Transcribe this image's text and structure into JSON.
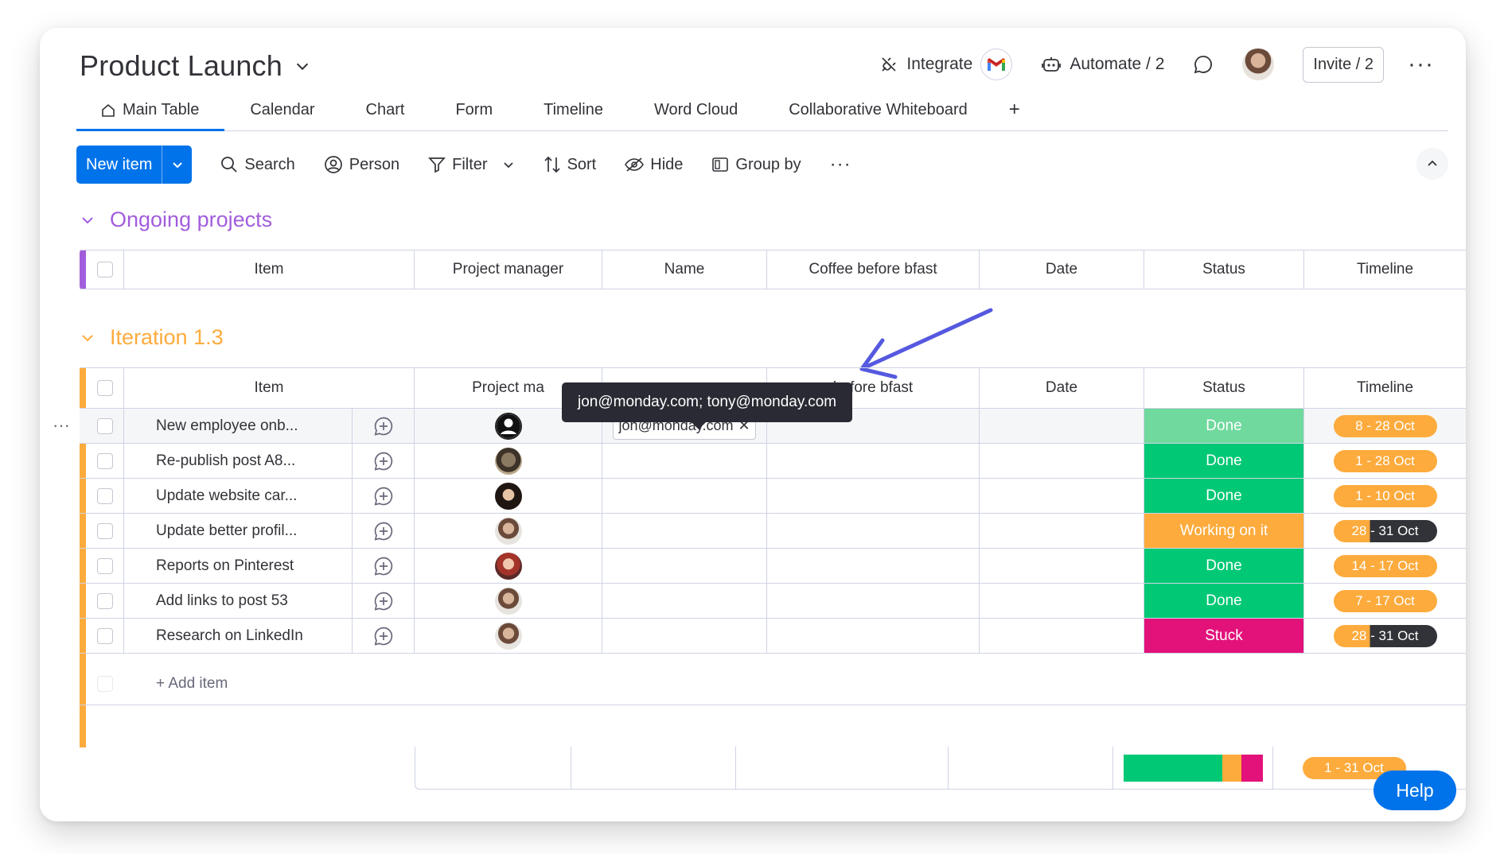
{
  "board": {
    "title": "Product Launch"
  },
  "header": {
    "integrate_label": "Integrate",
    "automate_label": "Automate / 2",
    "invite_label": "Invite / 2",
    "more": "···"
  },
  "tabs": [
    {
      "label": "Main Table",
      "active": true
    },
    {
      "label": "Calendar"
    },
    {
      "label": "Chart"
    },
    {
      "label": "Form"
    },
    {
      "label": "Timeline"
    },
    {
      "label": "Word Cloud"
    },
    {
      "label": "Collaborative Whiteboard"
    }
  ],
  "tab_add": "+",
  "toolbar": {
    "new_item": "New item",
    "search": "Search",
    "person": "Person",
    "filter": "Filter",
    "sort": "Sort",
    "hide": "Hide",
    "group_by": "Group by",
    "more": "···"
  },
  "columns": [
    "Item",
    "Project manager",
    "Name",
    "Coffee before bfast",
    "Date",
    "Status",
    "Timeline"
  ],
  "groups": {
    "ongoing": {
      "title": "Ongoing projects",
      "color": "#a25ddc"
    },
    "iteration": {
      "title": "Iteration 1.3",
      "color": "#fdab3d"
    }
  },
  "iteration_header": {
    "item": "Item",
    "project_manager_partial": "Project ma",
    "coffee_partial": "before bfast",
    "date": "Date",
    "status": "Status",
    "timeline": "Timeline"
  },
  "rows": [
    {
      "item": "New employee onb...",
      "status": "Done",
      "status_color": "#70d99e",
      "timeline": "8 - 28 Oct",
      "email": "jon@monday.com",
      "avatar": "silhouette"
    },
    {
      "item": "Re-publish post A8...",
      "status": "Done",
      "status_color": "#00c875",
      "timeline": "1 - 28 Oct",
      "avatar": "dog"
    },
    {
      "item": "Update website car...",
      "status": "Done",
      "status_color": "#00c875",
      "timeline": "1 - 10 Oct",
      "avatar": "woman-dark"
    },
    {
      "item": "Update better profil...",
      "status": "Working on it",
      "status_color": "#fdab3d",
      "timeline": "28 - 31 Oct",
      "timeline_progress": 0.35,
      "avatar": "woman-light"
    },
    {
      "item": "Reports on Pinterest",
      "status": "Done",
      "status_color": "#00c875",
      "timeline": "14 - 17 Oct",
      "avatar": "woman-red"
    },
    {
      "item": "Add links to post 53",
      "status": "Done",
      "status_color": "#00c875",
      "timeline": "7 - 17 Oct",
      "avatar": "woman-light"
    },
    {
      "item": "Research on LinkedIn",
      "status": "Stuck",
      "status_color": "#e2127a",
      "timeline": "28 - 31 Oct",
      "timeline_progress": 0.35,
      "avatar": "woman-light"
    }
  ],
  "add_item": "+ Add item",
  "tooltip": "jon@monday.com; tony@monday.com",
  "summary": {
    "status_breakdown": [
      {
        "color": "#00c875",
        "share": 0.71
      },
      {
        "color": "#fdab3d",
        "share": 0.14
      },
      {
        "color": "#e2127a",
        "share": 0.15
      }
    ],
    "timeline": "1 - 31 Oct"
  },
  "help": "Help",
  "row_menu": "···"
}
